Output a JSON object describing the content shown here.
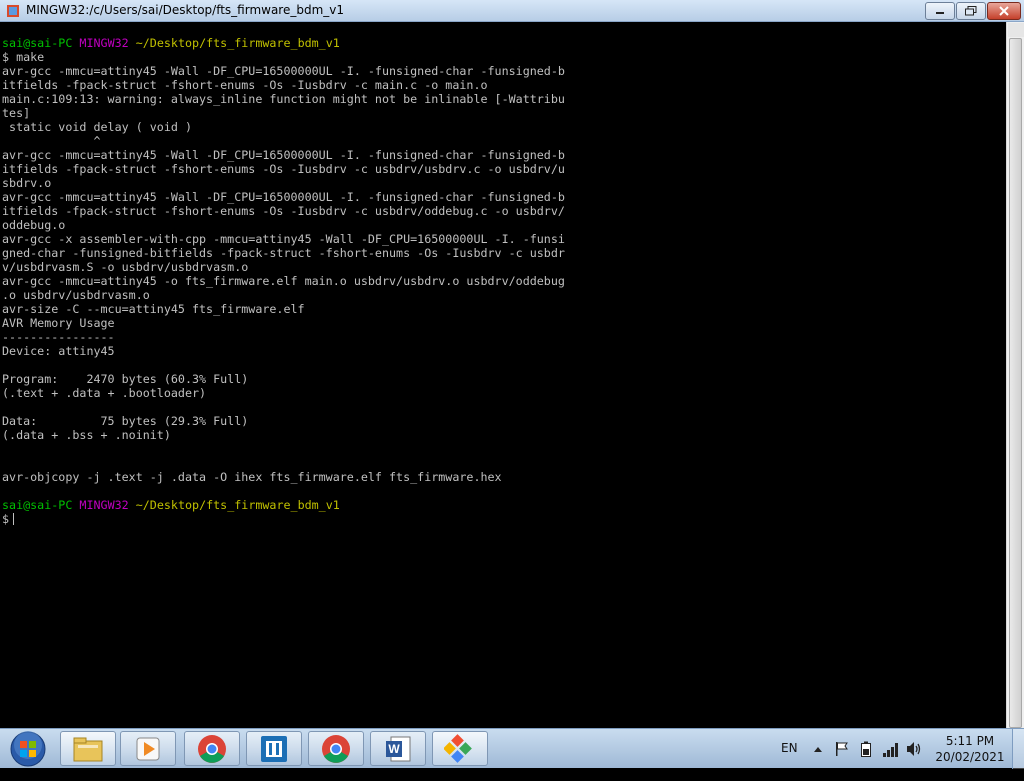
{
  "window": {
    "title": "MINGW32:/c/Users/sai/Desktop/fts_firmware_bdm_v1"
  },
  "terminal": {
    "prompt_user": "sai@sai-PC",
    "prompt_system": "MINGW32",
    "prompt_path": "~/Desktop/fts_firmware_bdm_v1",
    "command": "$ make",
    "output": [
      "avr-gcc -mmcu=attiny45 -Wall -DF_CPU=16500000UL -I. -funsigned-char -funsigned-b",
      "itfields -fpack-struct -fshort-enums -Os -Iusbdrv -c main.c -o main.o",
      "main.c:109:13: warning: always_inline function might not be inlinable [-Wattribu",
      "tes]",
      " static void delay ( void )",
      "             ^",
      "avr-gcc -mmcu=attiny45 -Wall -DF_CPU=16500000UL -I. -funsigned-char -funsigned-b",
      "itfields -fpack-struct -fshort-enums -Os -Iusbdrv -c usbdrv/usbdrv.c -o usbdrv/u",
      "sbdrv.o",
      "avr-gcc -mmcu=attiny45 -Wall -DF_CPU=16500000UL -I. -funsigned-char -funsigned-b",
      "itfields -fpack-struct -fshort-enums -Os -Iusbdrv -c usbdrv/oddebug.c -o usbdrv/",
      "oddebug.o",
      "avr-gcc -x assembler-with-cpp -mmcu=attiny45 -Wall -DF_CPU=16500000UL -I. -funsi",
      "gned-char -funsigned-bitfields -fpack-struct -fshort-enums -Os -Iusbdrv -c usbdr",
      "v/usbdrvasm.S -o usbdrv/usbdrvasm.o",
      "avr-gcc -mmcu=attiny45 -o fts_firmware.elf main.o usbdrv/usbdrv.o usbdrv/oddebug",
      ".o usbdrv/usbdrvasm.o",
      "avr-size -C --mcu=attiny45 fts_firmware.elf",
      "AVR Memory Usage",
      "----------------",
      "Device: attiny45",
      "",
      "Program:    2470 bytes (60.3% Full)",
      "(.text + .data + .bootloader)",
      "",
      "Data:         75 bytes (29.3% Full)",
      "(.data + .bss + .noinit)",
      "",
      "",
      "avr-objcopy -j .text -j .data -O ihex fts_firmware.elf fts_firmware.hex",
      ""
    ],
    "final_prompt": "$"
  },
  "taskbar": {
    "apps": [
      {
        "name": "windows-explorer",
        "icon": "folder-icon"
      },
      {
        "name": "media-player",
        "icon": "play-icon"
      },
      {
        "name": "chrome",
        "icon": "chrome-icon"
      },
      {
        "name": "app-brackets",
        "icon": "brackets-icon"
      },
      {
        "name": "chrome-2",
        "icon": "chrome-icon"
      },
      {
        "name": "word",
        "icon": "word-icon"
      },
      {
        "name": "git-bash",
        "icon": "git-icon"
      }
    ],
    "language": "EN",
    "time": "5:11 PM",
    "date": "20/02/2021"
  },
  "colors": {
    "prompt_user": "#00c000",
    "prompt_system": "#c000c0",
    "prompt_path": "#c0c000",
    "text": "#c0c0c0"
  }
}
